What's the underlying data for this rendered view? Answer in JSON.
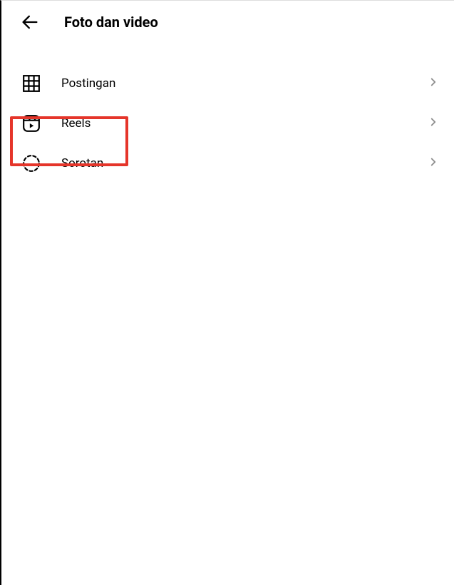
{
  "header": {
    "title": "Foto dan video"
  },
  "menu": {
    "items": [
      {
        "label": "Postingan",
        "icon": "grid-icon"
      },
      {
        "label": "Reels",
        "icon": "reels-icon"
      },
      {
        "label": "Sorotan",
        "icon": "highlights-icon"
      }
    ]
  }
}
